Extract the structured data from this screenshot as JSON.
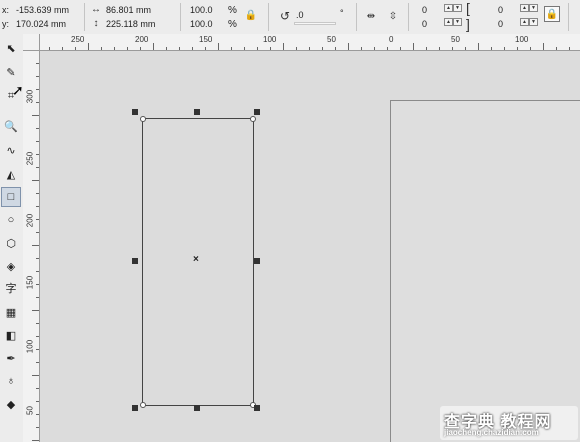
{
  "property_bar": {
    "x_label": "x:",
    "x_value": "-153.639 mm",
    "y_label": "y:",
    "y_value": "170.024 mm",
    "width_value": "86.801 mm",
    "height_value": "225.118 mm",
    "scale_x": "100.0",
    "scale_y": "100.0",
    "percent_x": "%",
    "percent_y": "%",
    "rotation_value": ".0",
    "degree_sign": "°",
    "corner_tl": "0",
    "corner_bl": "0",
    "corner_tr": "0",
    "corner_br": "0"
  },
  "toolbox": {
    "tools": [
      {
        "icon": "pick-tool-icon",
        "glyph": "⬉"
      },
      {
        "icon": "shape-tool-icon",
        "glyph": "✎"
      },
      {
        "icon": "crop-tool-icon",
        "glyph": "⌗"
      },
      {
        "icon": "zoom-tool-icon",
        "glyph": "🔍"
      },
      {
        "icon": "freehand-tool-icon",
        "glyph": "∿"
      },
      {
        "icon": "smart-fill-icon",
        "glyph": "◭"
      },
      {
        "icon": "rectangle-tool-icon",
        "glyph": "□"
      },
      {
        "icon": "ellipse-tool-icon",
        "glyph": "○"
      },
      {
        "icon": "polygon-tool-icon",
        "glyph": "⬡"
      },
      {
        "icon": "basic-shapes-icon",
        "glyph": "◈"
      },
      {
        "icon": "text-tool-icon",
        "glyph": "字"
      },
      {
        "icon": "table-tool-icon",
        "glyph": "▦"
      },
      {
        "icon": "interactive-tool-icon",
        "glyph": "◧"
      },
      {
        "icon": "eyedropper-tool-icon",
        "glyph": "✒"
      },
      {
        "icon": "outline-pen-icon",
        "glyph": "♁"
      },
      {
        "icon": "fill-tool-icon",
        "glyph": "◆"
      }
    ],
    "active_index": 6
  },
  "rulers": {
    "horizontal_labels": [
      "250",
      "200",
      "150",
      "100",
      "50",
      "0",
      "50",
      "100"
    ],
    "vertical_labels": [
      "300",
      "250",
      "200",
      "150",
      "100",
      "50"
    ]
  },
  "watermark": {
    "brand": "查字典 教程网",
    "url": "jiaocheng.chazidian.com"
  }
}
